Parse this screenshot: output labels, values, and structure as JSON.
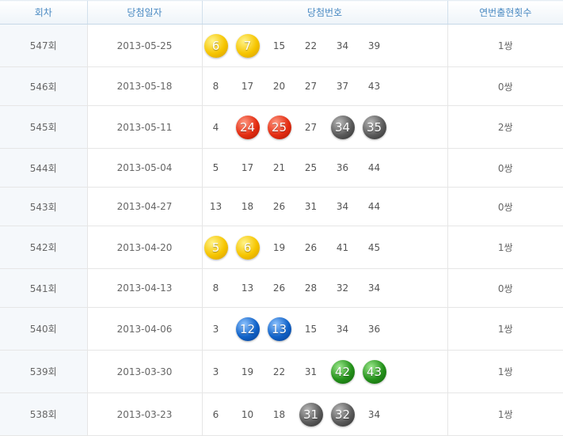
{
  "table": {
    "headers": {
      "round": "회차",
      "date": "당첨일자",
      "numbers": "당첨번호",
      "pairs": "연번출현횟수"
    },
    "ball_colors": {
      "yellow": "#f6c500",
      "red": "#e42d12",
      "gray": "#5b5b5b",
      "blue": "#1062c8",
      "green": "#24911a"
    },
    "rows": [
      {
        "round": "547회",
        "date": "2013-05-25",
        "pairs": "1쌍",
        "numbers": [
          {
            "value": "6",
            "ball": "yellow"
          },
          {
            "value": "7",
            "ball": "yellow"
          },
          {
            "value": "15",
            "ball": null
          },
          {
            "value": "22",
            "ball": null
          },
          {
            "value": "34",
            "ball": null
          },
          {
            "value": "39",
            "ball": null
          }
        ]
      },
      {
        "round": "546회",
        "date": "2013-05-18",
        "pairs": "0쌍",
        "numbers": [
          {
            "value": "8",
            "ball": null
          },
          {
            "value": "17",
            "ball": null
          },
          {
            "value": "20",
            "ball": null
          },
          {
            "value": "27",
            "ball": null
          },
          {
            "value": "37",
            "ball": null
          },
          {
            "value": "43",
            "ball": null
          }
        ]
      },
      {
        "round": "545회",
        "date": "2013-05-11",
        "pairs": "2쌍",
        "numbers": [
          {
            "value": "4",
            "ball": null
          },
          {
            "value": "24",
            "ball": "red"
          },
          {
            "value": "25",
            "ball": "red"
          },
          {
            "value": "27",
            "ball": null
          },
          {
            "value": "34",
            "ball": "gray"
          },
          {
            "value": "35",
            "ball": "gray"
          }
        ]
      },
      {
        "round": "544회",
        "date": "2013-05-04",
        "pairs": "0쌍",
        "numbers": [
          {
            "value": "5",
            "ball": null
          },
          {
            "value": "17",
            "ball": null
          },
          {
            "value": "21",
            "ball": null
          },
          {
            "value": "25",
            "ball": null
          },
          {
            "value": "36",
            "ball": null
          },
          {
            "value": "44",
            "ball": null
          }
        ]
      },
      {
        "round": "543회",
        "date": "2013-04-27",
        "pairs": "0쌍",
        "numbers": [
          {
            "value": "13",
            "ball": null
          },
          {
            "value": "18",
            "ball": null
          },
          {
            "value": "26",
            "ball": null
          },
          {
            "value": "31",
            "ball": null
          },
          {
            "value": "34",
            "ball": null
          },
          {
            "value": "44",
            "ball": null
          }
        ]
      },
      {
        "round": "542회",
        "date": "2013-04-20",
        "pairs": "1쌍",
        "numbers": [
          {
            "value": "5",
            "ball": "yellow"
          },
          {
            "value": "6",
            "ball": "yellow"
          },
          {
            "value": "19",
            "ball": null
          },
          {
            "value": "26",
            "ball": null
          },
          {
            "value": "41",
            "ball": null
          },
          {
            "value": "45",
            "ball": null
          }
        ]
      },
      {
        "round": "541회",
        "date": "2013-04-13",
        "pairs": "0쌍",
        "numbers": [
          {
            "value": "8",
            "ball": null
          },
          {
            "value": "13",
            "ball": null
          },
          {
            "value": "26",
            "ball": null
          },
          {
            "value": "28",
            "ball": null
          },
          {
            "value": "32",
            "ball": null
          },
          {
            "value": "34",
            "ball": null
          }
        ]
      },
      {
        "round": "540회",
        "date": "2013-04-06",
        "pairs": "1쌍",
        "numbers": [
          {
            "value": "3",
            "ball": null
          },
          {
            "value": "12",
            "ball": "blue"
          },
          {
            "value": "13",
            "ball": "blue"
          },
          {
            "value": "15",
            "ball": null
          },
          {
            "value": "34",
            "ball": null
          },
          {
            "value": "36",
            "ball": null
          }
        ]
      },
      {
        "round": "539회",
        "date": "2013-03-30",
        "pairs": "1쌍",
        "numbers": [
          {
            "value": "3",
            "ball": null
          },
          {
            "value": "19",
            "ball": null
          },
          {
            "value": "22",
            "ball": null
          },
          {
            "value": "31",
            "ball": null
          },
          {
            "value": "42",
            "ball": "green"
          },
          {
            "value": "43",
            "ball": "green"
          }
        ]
      },
      {
        "round": "538회",
        "date": "2013-03-23",
        "pairs": "1쌍",
        "numbers": [
          {
            "value": "6",
            "ball": null
          },
          {
            "value": "10",
            "ball": null
          },
          {
            "value": "18",
            "ball": null
          },
          {
            "value": "31",
            "ball": "gray"
          },
          {
            "value": "32",
            "ball": "gray"
          },
          {
            "value": "34",
            "ball": null
          }
        ]
      }
    ]
  }
}
